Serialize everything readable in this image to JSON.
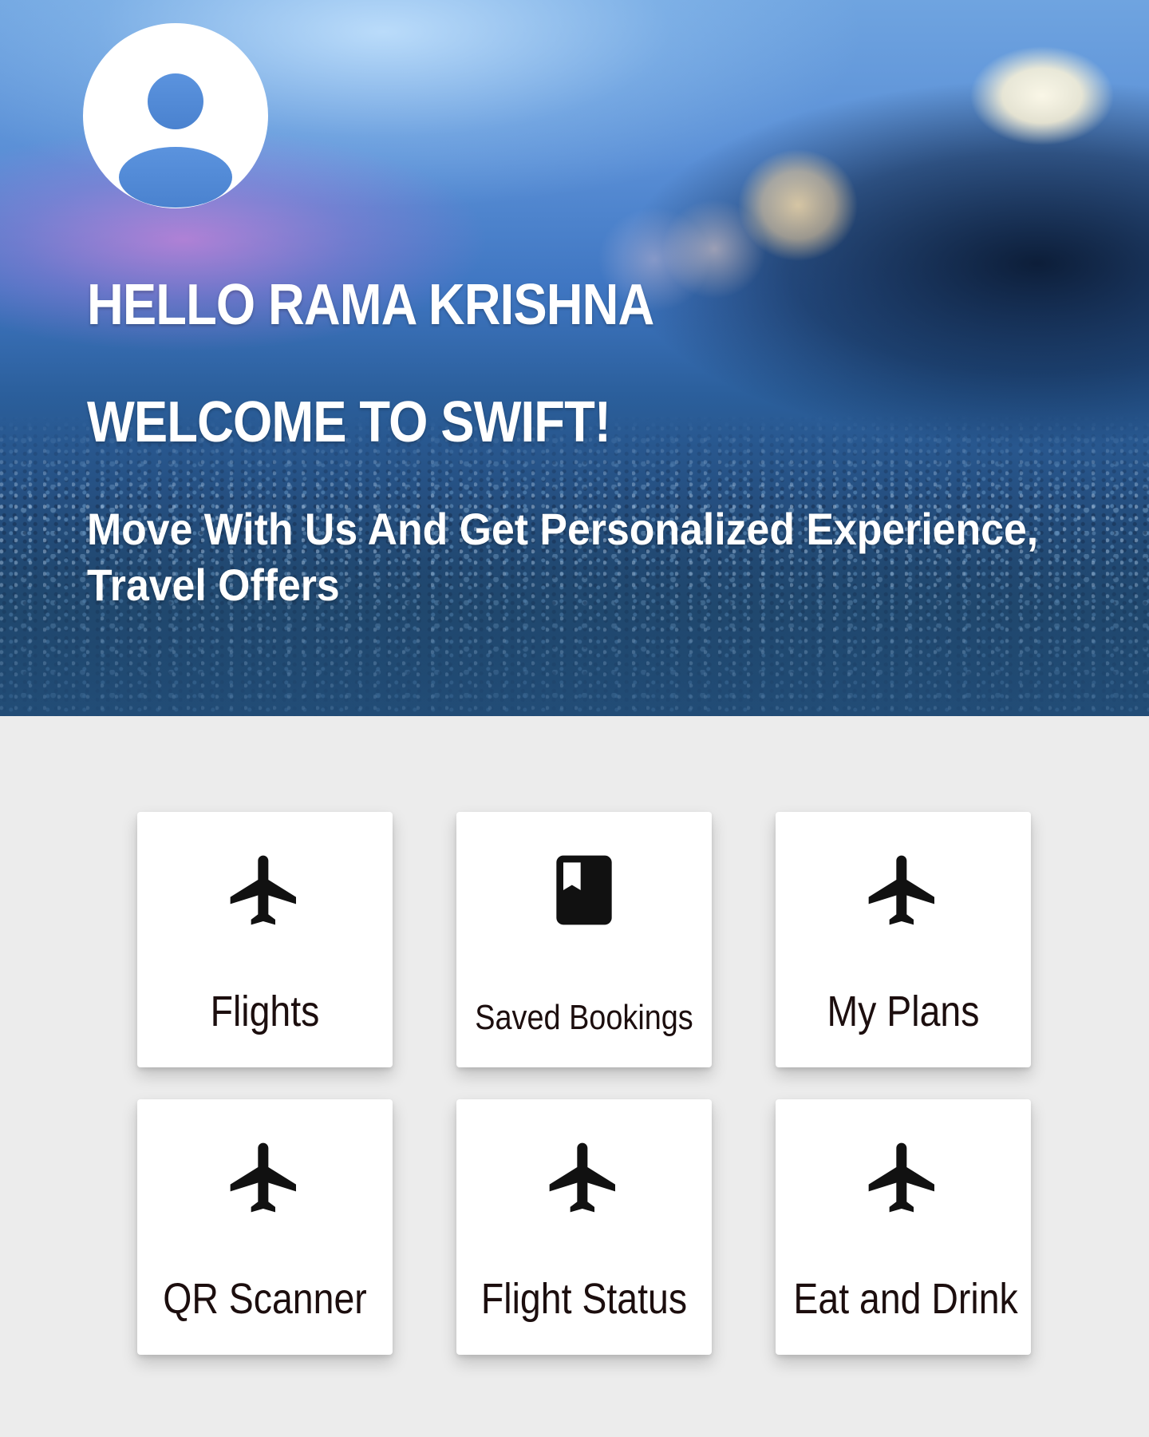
{
  "header": {
    "greeting": "HELLO RAMA KRISHNA",
    "welcome": "WELCOME TO SWIFT!",
    "tagline": "Move With Us And Get Personalized Experience, Travel Offers"
  },
  "profile": {
    "avatar_icon": "account-circle-icon"
  },
  "tiles": [
    {
      "label": "Flights",
      "icon": "airplane-icon"
    },
    {
      "label": "Saved Bookings",
      "icon": "bookmark-book-icon"
    },
    {
      "label": "My Plans",
      "icon": "airplane-icon"
    },
    {
      "label": "QR Scanner",
      "icon": "airplane-icon"
    },
    {
      "label": "Flight Status",
      "icon": "airplane-icon"
    },
    {
      "label": "Eat and Drink",
      "icon": "airplane-icon"
    }
  ],
  "colors": {
    "page_background": "#ececec",
    "tile_background": "#ffffff",
    "tile_label": "#1c0e0e",
    "icon": "#111111",
    "hero_text": "#ffffff"
  }
}
